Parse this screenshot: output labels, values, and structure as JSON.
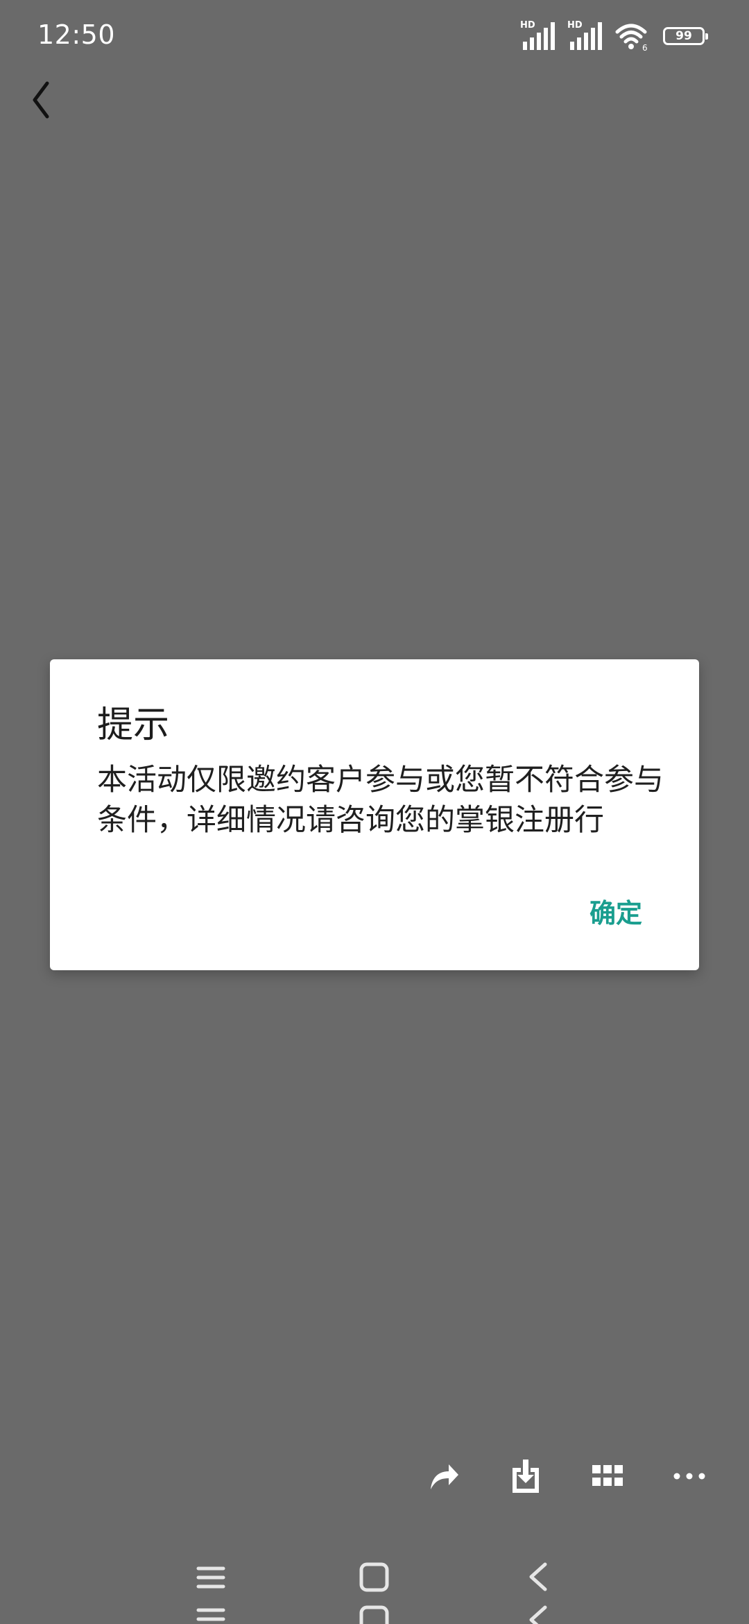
{
  "status_bar": {
    "time": "12:50",
    "signal1_label": "HD",
    "signal2_label": "HD",
    "wifi_badge": "6",
    "battery": "99",
    "icons": [
      "hd-signal-icon",
      "hd-signal-icon",
      "wifi-icon",
      "battery-icon"
    ]
  },
  "header": {
    "back_icon": "chevron-left-icon"
  },
  "dialog": {
    "title": "提示",
    "message": "本活动仅限邀约客户参与或您暂不符合参与条件，详细情况请咨询您的掌银注册行",
    "confirm_label": "确定",
    "accent_color": "#1a9e8f"
  },
  "toolbar": {
    "icons": [
      "share-icon",
      "download-icon",
      "grid-icon",
      "more-icon"
    ]
  },
  "nav_bar": {
    "icons": [
      "menu-icon",
      "home-icon",
      "back-icon"
    ]
  },
  "colors": {
    "background": "#6a6a6a",
    "dialog": "#ffffff"
  }
}
